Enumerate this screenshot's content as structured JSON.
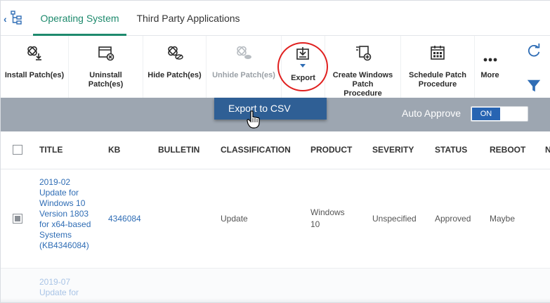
{
  "tabs": [
    {
      "label": "Operating System",
      "active": true
    },
    {
      "label": "Third Party Applications",
      "active": false
    }
  ],
  "toolbar": {
    "install": "Install Patch(es)",
    "uninstall": "Uninstall Patch(es)",
    "hide": "Hide Patch(es)",
    "unhide": "Unhide Patch(es)",
    "export": "Export",
    "create_procedure": "Create Windows Patch Procedure",
    "schedule_procedure": "Schedule Patch Procedure",
    "more": "More"
  },
  "dropdown": {
    "export_csv": "Export to CSV"
  },
  "auto_approve": {
    "label": "Auto Approve",
    "state": "ON"
  },
  "table": {
    "columns": [
      "TITLE",
      "KB",
      "BULLETIN",
      "CLASSIFICATION",
      "PRODUCT",
      "SEVERITY",
      "STATUS",
      "REBOOT",
      "N"
    ],
    "rows": [
      {
        "title_lines": [
          "2019-02",
          "Update for",
          "Windows 10",
          "Version 1803",
          "for x64-based",
          "Systems",
          "(KB4346084)"
        ],
        "kb": "4346084",
        "bulletin": "",
        "classification": "Update",
        "product_lines": [
          "Windows",
          "10"
        ],
        "severity": "Unspecified",
        "status": "Approved",
        "reboot": "Maybe"
      },
      {
        "title_lines": [
          "2019-07",
          "Update for"
        ]
      }
    ]
  },
  "colors": {
    "accent": "#1e8a6d",
    "link": "#2f6db5",
    "band": "#9da6b1",
    "dropdown": "#2f5f95",
    "toggle_on": "#2764b2",
    "annotation": "#e0201f"
  }
}
